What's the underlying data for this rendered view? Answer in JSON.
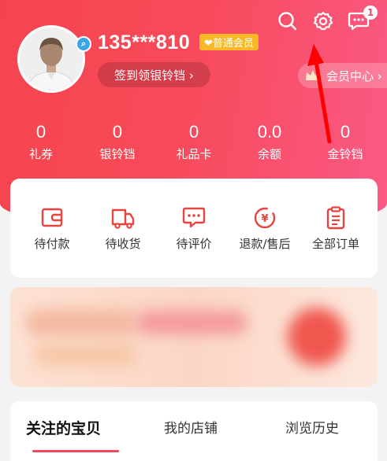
{
  "header": {
    "badge_count": "1",
    "phone": "135***810",
    "member_tag": "❤普通会员",
    "checkin_label": "签到领银铃铛 ›",
    "member_center_label": "会员中心 ›",
    "icons": [
      "search-icon",
      "settings-icon",
      "message-icon"
    ],
    "accent_color": "#f6444f"
  },
  "stats": [
    {
      "value": "0",
      "label": "礼券"
    },
    {
      "value": "0",
      "label": "银铃铛"
    },
    {
      "value": "0",
      "label": "礼品卡"
    },
    {
      "value": "0.0",
      "label": "余额"
    },
    {
      "value": "0",
      "label": "金铃铛"
    }
  ],
  "orders": [
    {
      "label": "待付款",
      "icon": "wallet-icon"
    },
    {
      "label": "待收货",
      "icon": "truck-icon"
    },
    {
      "label": "待评价",
      "icon": "comment-icon"
    },
    {
      "label": "退款/售后",
      "icon": "refund-icon"
    },
    {
      "label": "全部订单",
      "icon": "order-list-icon"
    }
  ],
  "tabs": [
    {
      "label": "关注的宝贝",
      "active": true
    },
    {
      "label": "我的店铺",
      "active": false
    },
    {
      "label": "浏览历史",
      "active": false
    }
  ]
}
